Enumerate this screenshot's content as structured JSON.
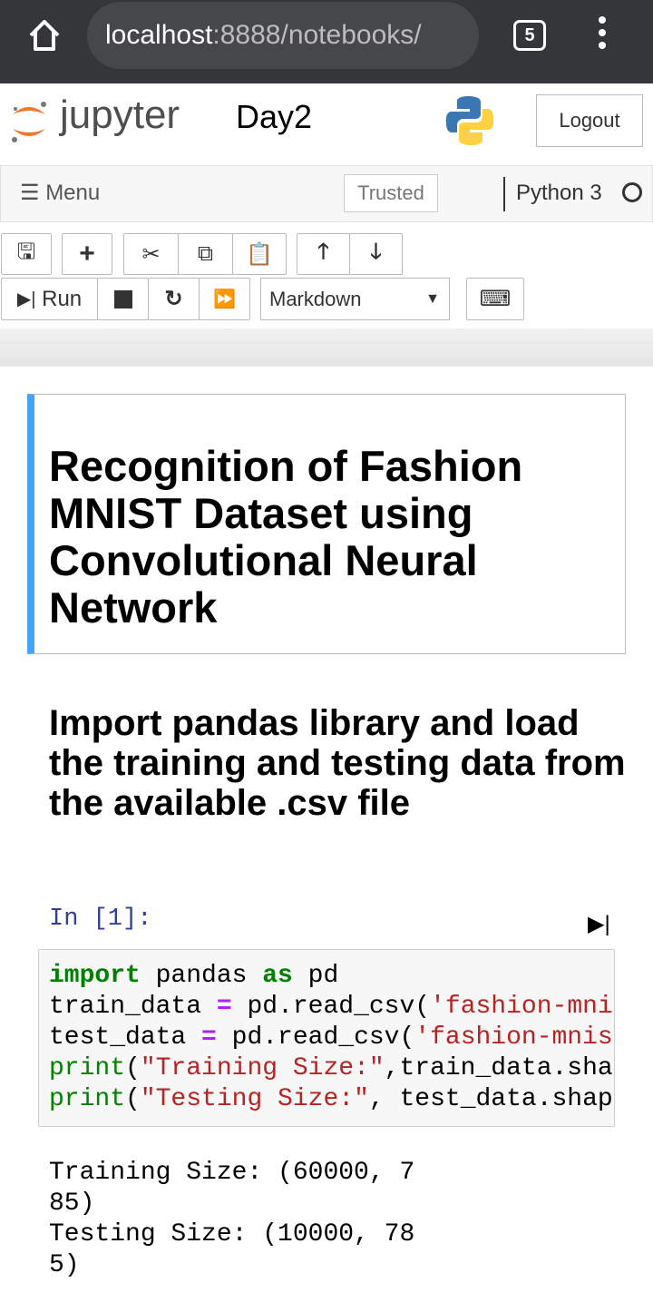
{
  "browser": {
    "url_host": "localhost",
    "url_rest": ":8888/notebooks/",
    "tab_count": "5",
    "icons": [
      "home-icon",
      "tabs-icon",
      "kebab-menu-icon"
    ]
  },
  "header": {
    "logo_text": "jupyter",
    "notebook_name": "Day2",
    "logout_label": "Logout"
  },
  "menubar": {
    "menu_label": "Menu",
    "trusted_label": "Trusted",
    "kernel_name": "Python 3"
  },
  "toolbar": {
    "run_label": "Run",
    "cell_type": "Markdown"
  },
  "cells": {
    "title": "Recognition of Fashion MNIST Dataset using Convolutional Neural Network",
    "heading": "Import pandas library and load the training and testing data from the available .csv file",
    "prompt": "In [1]:",
    "code": [
      [
        {
          "t": "import",
          "c": "kw"
        },
        {
          "t": " pandas ",
          "c": ""
        },
        {
          "t": "as",
          "c": "kw"
        },
        {
          "t": " pd",
          "c": ""
        }
      ],
      [
        {
          "t": "train_data ",
          "c": ""
        },
        {
          "t": "=",
          "c": "op"
        },
        {
          "t": " pd.read_csv(",
          "c": ""
        },
        {
          "t": "'fashion-mni",
          "c": "st"
        }
      ],
      [
        {
          "t": "test_data ",
          "c": ""
        },
        {
          "t": "=",
          "c": "op"
        },
        {
          "t": " pd.read_csv(",
          "c": ""
        },
        {
          "t": "'fashion-mnis",
          "c": "st"
        }
      ],
      [
        {
          "t": "print",
          "c": "bi"
        },
        {
          "t": "(",
          "c": ""
        },
        {
          "t": "\"Training Size:\"",
          "c": "st"
        },
        {
          "t": ",train_data.sha",
          "c": ""
        }
      ],
      [
        {
          "t": "print",
          "c": "bi"
        },
        {
          "t": "(",
          "c": ""
        },
        {
          "t": "\"Testing Size:\"",
          "c": "st"
        },
        {
          "t": ", test_data.shap",
          "c": ""
        }
      ]
    ],
    "output": [
      "Training Size: (60000, 7",
      "85)",
      "Testing Size: (10000, 78",
      "5)"
    ]
  },
  "colors": {
    "accent": "#42a5f5",
    "browser_bar": "#35363a"
  }
}
